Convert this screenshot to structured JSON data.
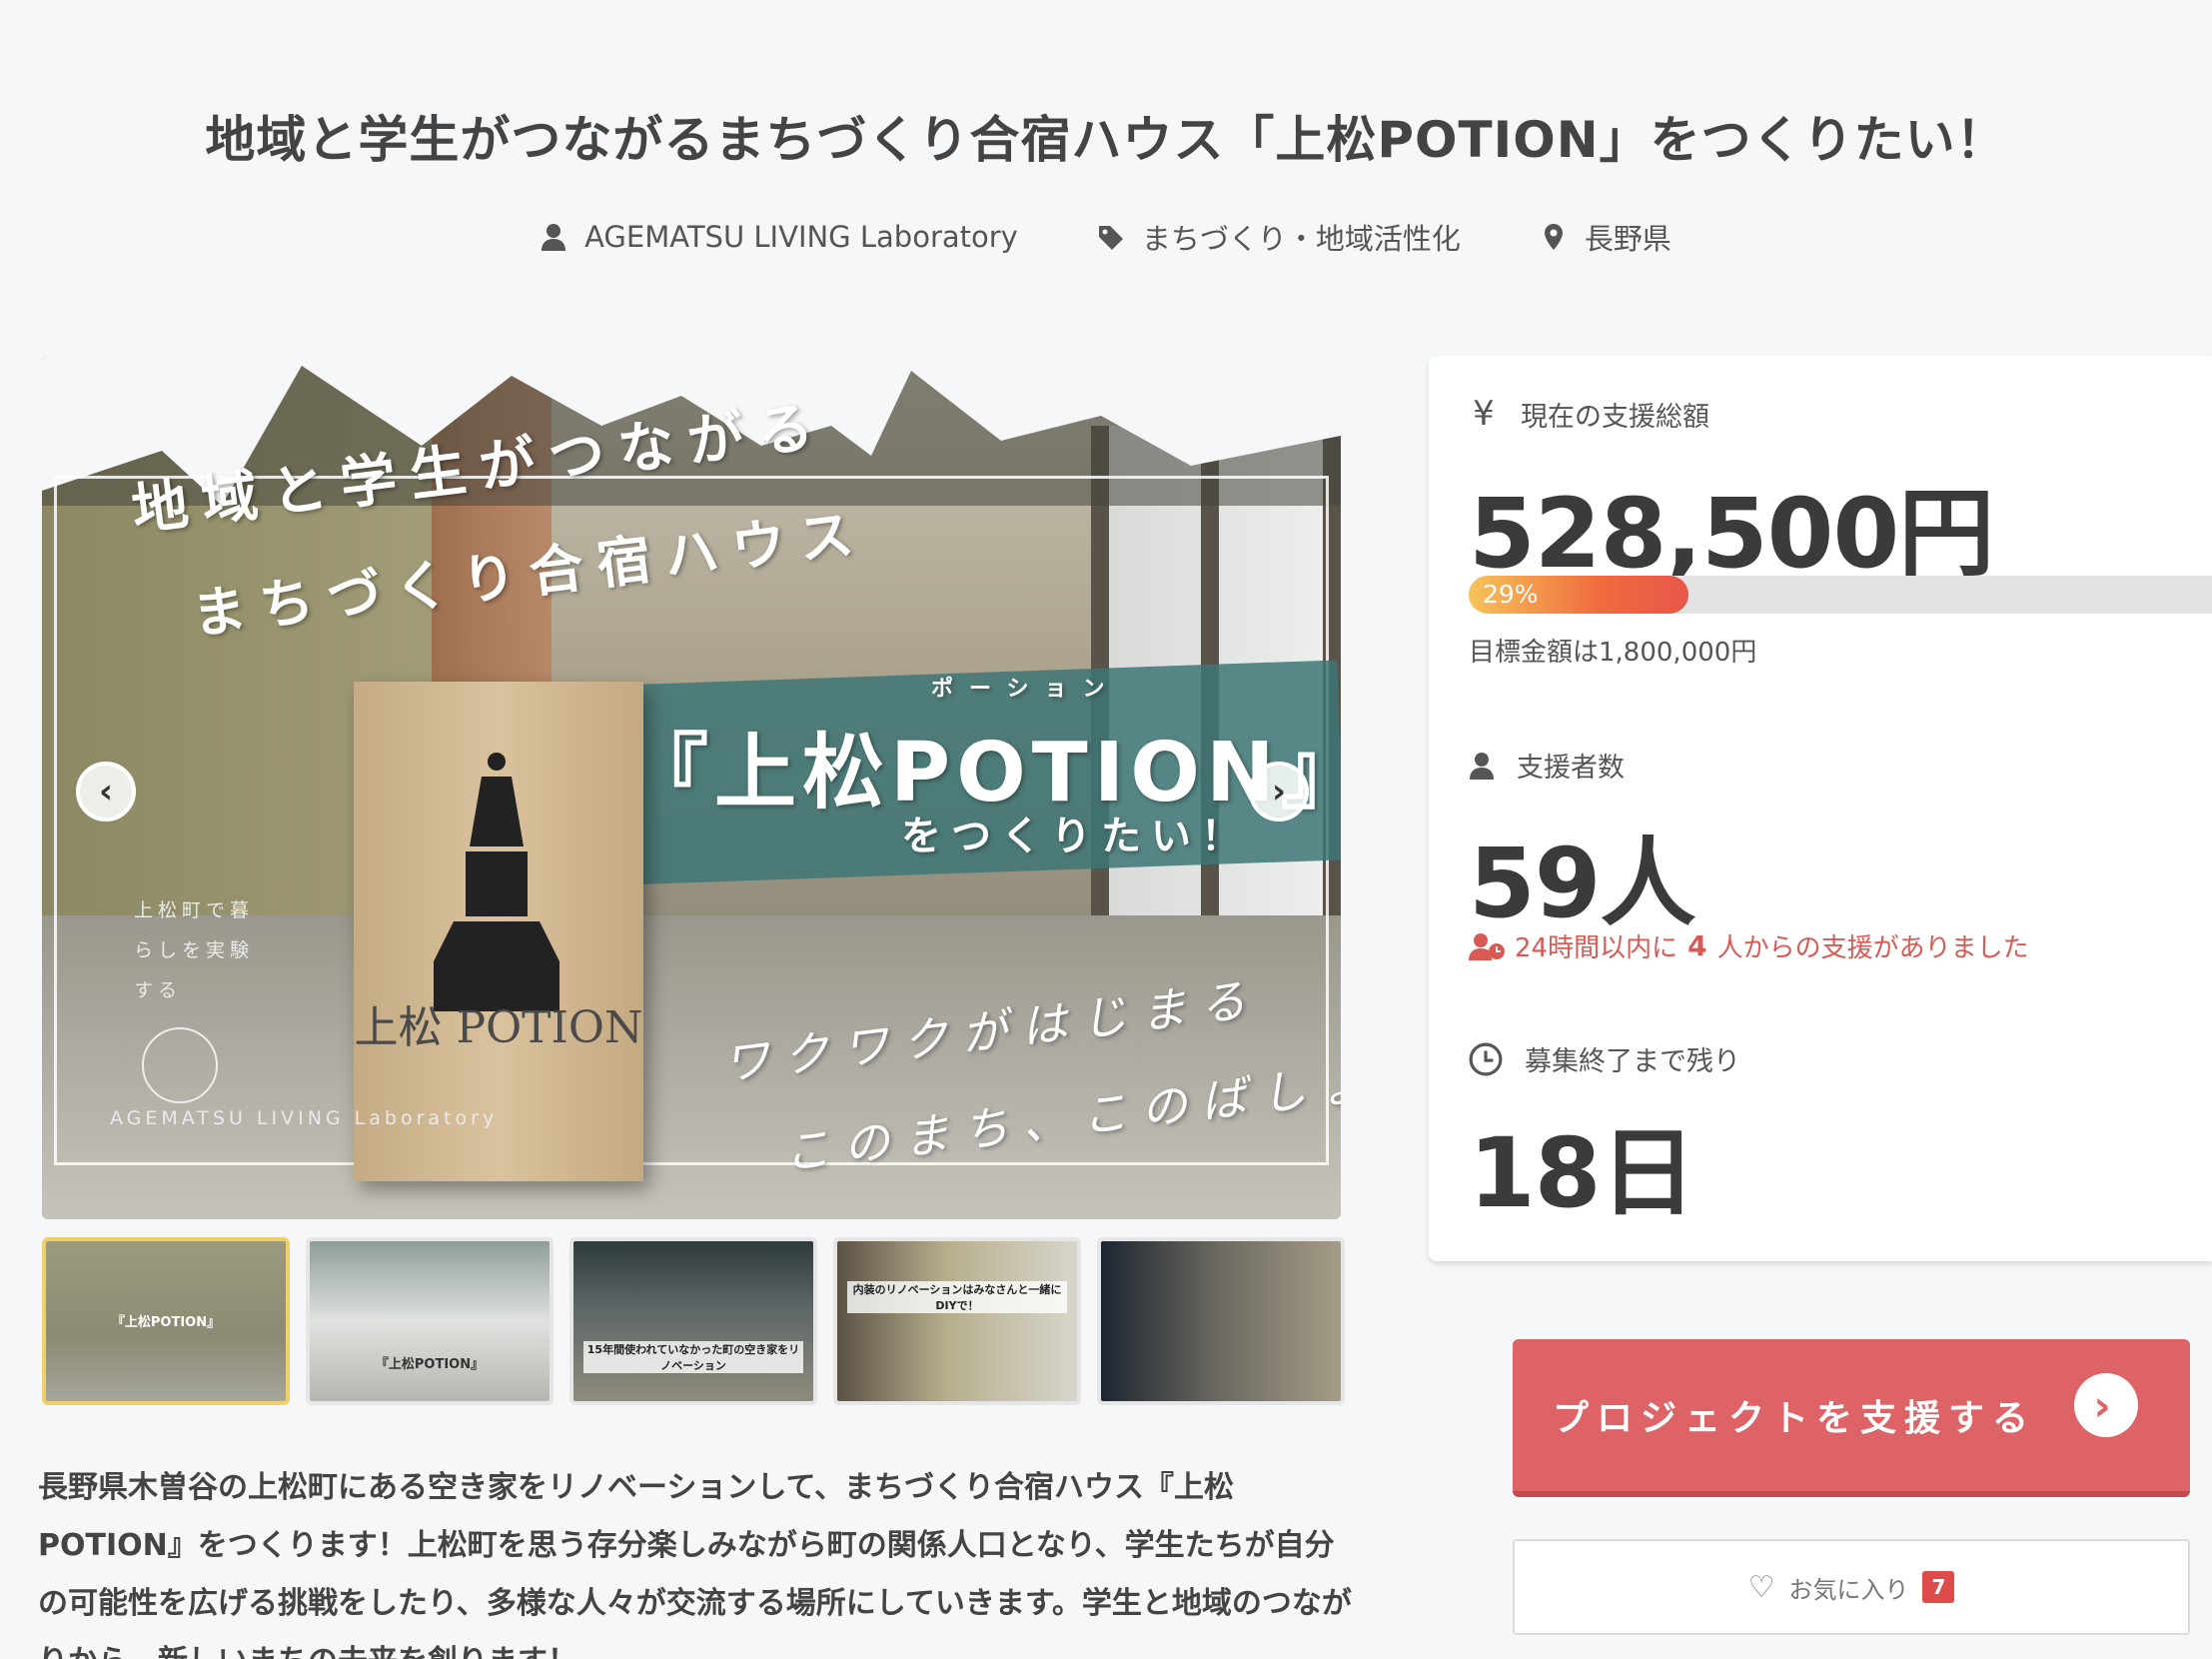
{
  "title": "地域と学生がつながるまちづくり合宿ハウス「上松POTION」をつくりたい！",
  "meta": {
    "owner": "AGEMATSU LIVING Laboratory",
    "category": "まちづくり・地域活性化",
    "location": "長野県"
  },
  "hero": {
    "line1": "地域と学生がつながる",
    "line2": "まちづくり合宿ハウス",
    "ruby": "ポーション",
    "potion": "『上松POTION』",
    "tsukuri": "をつくりたい！",
    "side_text": "上松町で暮らしを実験する",
    "logo_text": "AGEMATSU LIVING Laboratory",
    "sign_text": "上松 POTION",
    "hand1": "ワクワクがはじまる",
    "hand2": "このまち、このばしょ。"
  },
  "thumbnails": [
    {
      "caption": "『上松POTION』",
      "active": true
    },
    {
      "caption": "『上松POTION』",
      "active": false
    },
    {
      "caption": "15年間使われていなかった町の空き家をリノベーション",
      "active": false
    },
    {
      "caption": "内装のリノベーションはみなさんと一緒にDIYで！",
      "active": false
    },
    {
      "caption": "",
      "active": false
    }
  ],
  "description": "長野県木曽谷の上松町にある空き家をリノベーションして、まちづくり合宿ハウス『上松POTION』をつくります！上松町を思う存分楽しみながら町の関係人口となり、学生たちが自分の可能性を広げる挑戦をしたり、多様な人々が交流する場所にしていきます。学生と地域のつながりから、新しいまちの未来を創ります！",
  "stats": {
    "amount_label": "現在の支援総額",
    "amount": "528,500円",
    "progress_percent": 29,
    "progress_text": "29%",
    "goal": "目標金額は1,800,000円",
    "backers_label": "支援者数",
    "backers": "59人",
    "recent_prefix": "24時間以内に",
    "recent_count": "4",
    "recent_suffix": "人からの支援がありました",
    "remaining_label": "募集終了まで残り",
    "remaining": "18日"
  },
  "actions": {
    "support_label": "プロジェクトを支援する",
    "favorite_label": "お気に入り",
    "favorite_count": "7"
  },
  "colors": {
    "accent": "#dd6366",
    "progress_start": "#f7c35a",
    "progress_end": "#e8564a",
    "alert": "#d75a55"
  }
}
